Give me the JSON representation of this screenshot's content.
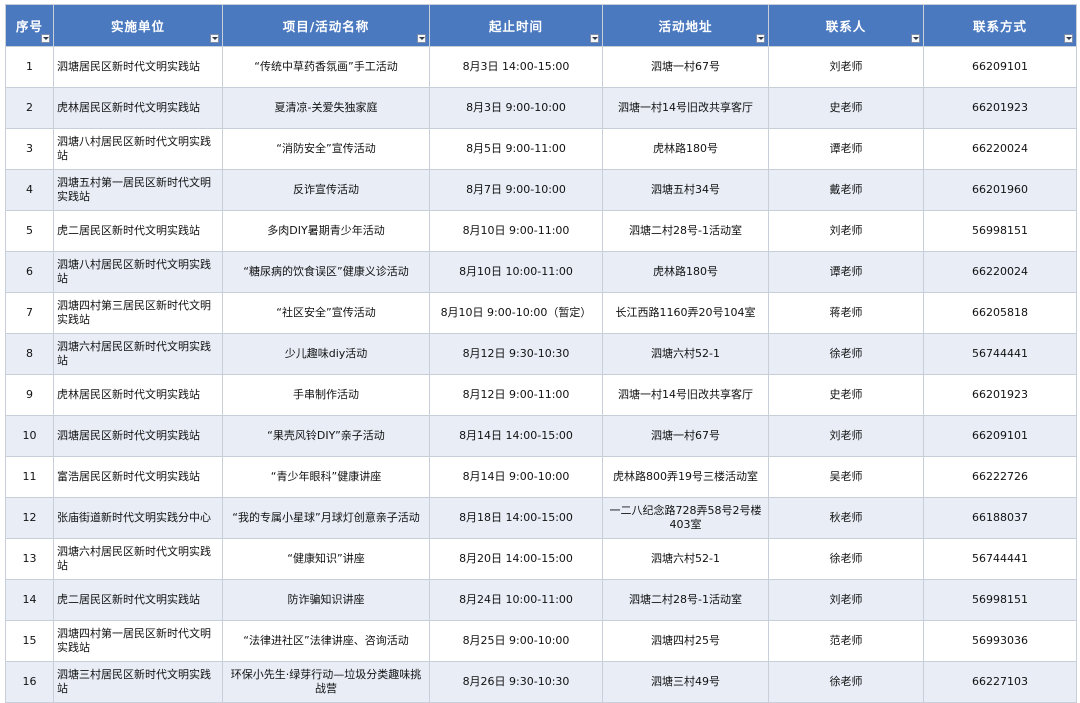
{
  "headers": [
    "序号",
    "实施单位",
    "项目/活动名称",
    "起止时间",
    "活动地址",
    "联系人",
    "联系方式"
  ],
  "rows": [
    [
      "1",
      "泗塘居民区新时代文明实践站",
      "“传统中草药香氛画”手工活动",
      "8月3日  14:00-15:00",
      "泗塘一村67号",
      "刘老师",
      "66209101"
    ],
    [
      "2",
      "虎林居民区新时代文明实践站",
      "夏清凉-关爱失独家庭",
      "8月3日  9:00-10:00",
      "泗塘一村14号旧改共享客厅",
      "史老师",
      "66201923"
    ],
    [
      "3",
      "泗塘八村居民区新时代文明实践站",
      "“消防安全”宣传活动",
      "8月5日  9:00-11:00",
      "虎林路180号",
      "谭老师",
      "66220024"
    ],
    [
      "4",
      "泗塘五村第一居民区新时代文明实践站",
      "反诈宣传活动",
      "8月7日  9:00-10:00",
      "泗塘五村34号",
      "戴老师",
      "66201960"
    ],
    [
      "5",
      "虎二居民区新时代文明实践站",
      "多肉DIY暑期青少年活动",
      "8月10日  9:00-11:00",
      "泗塘二村28号-1活动室",
      "刘老师",
      "56998151"
    ],
    [
      "6",
      "泗塘八村居民区新时代文明实践站",
      "“糖尿病的饮食误区”健康义诊活动",
      "8月10日  10:00-11:00",
      "虎林路180号",
      "谭老师",
      "66220024"
    ],
    [
      "7",
      "泗塘四村第三居民区新时代文明实践站",
      "“社区安全”宣传活动",
      "8月10日  9:00-10:00（暂定）",
      "长江西路1160弄20号104室",
      "蒋老师",
      "66205818"
    ],
    [
      "8",
      "泗塘六村居民区新时代文明实践站",
      "少儿趣味diy活动",
      "8月12日  9:30-10:30",
      "泗塘六村52-1",
      "徐老师",
      "56744441"
    ],
    [
      "9",
      "虎林居民区新时代文明实践站",
      "手串制作活动",
      "8月12日  9:00-11:00",
      "泗塘一村14号旧改共享客厅",
      "史老师",
      "66201923"
    ],
    [
      "10",
      "泗塘居民区新时代文明实践站",
      "“果壳风铃DIY”亲子活动",
      "8月14日  14:00-15:00",
      "泗塘一村67号",
      "刘老师",
      "66209101"
    ],
    [
      "11",
      "富浩居民区新时代文明实践站",
      "“青少年眼科”健康讲座",
      "8月14日  9:00-10:00",
      "虎林路800弄19号三楼活动室",
      "吴老师",
      "66222726"
    ],
    [
      "12",
      "张庙街道新时代文明实践分中心",
      "“我的专属小星球”月球灯创意亲子活动",
      "8月18日  14:00-15:00",
      "一二八纪念路728弄58号2号楼403室",
      "秋老师",
      "66188037"
    ],
    [
      "13",
      "泗塘六村居民区新时代文明实践站",
      "“健康知识”讲座",
      "8月20日  14:00-15:00",
      "泗塘六村52-1",
      "徐老师",
      "56744441"
    ],
    [
      "14",
      "虎二居民区新时代文明实践站",
      "防诈骗知识讲座",
      "8月24日  10:00-11:00",
      "泗塘二村28号-1活动室",
      "刘老师",
      "56998151"
    ],
    [
      "15",
      "泗塘四村第一居民区新时代文明实践站",
      "“法律进社区”法律讲座、咨询活动",
      "8月25日  9:00-10:00",
      "泗塘四村25号",
      "范老师",
      "56993036"
    ],
    [
      "16",
      "泗塘三村居民区新时代文明实践站",
      "环保小先生·绿芽行动—垃圾分类趣味挑战营",
      "8月26日  9:30-10:30",
      "泗塘三村49号",
      "徐老师",
      "66227103"
    ]
  ]
}
